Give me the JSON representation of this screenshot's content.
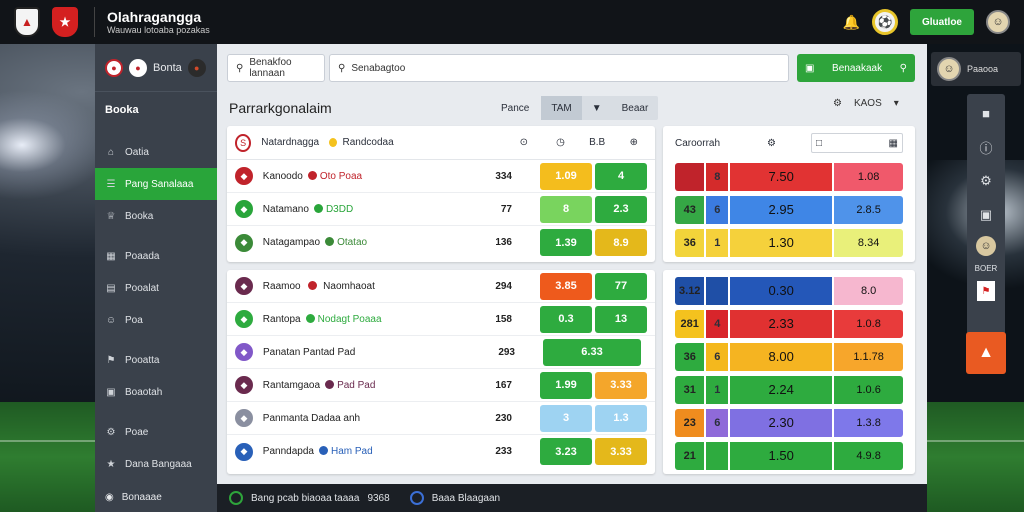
{
  "app": {
    "title": "Olahragangga",
    "subtitle": "Wauwau lotoaba pozakas"
  },
  "topbar": {
    "green_button": "Gluatloe",
    "ball_icon": "soccer-ball-icon",
    "bell_icon": "bell-icon"
  },
  "sidebar": {
    "heading": "Booka",
    "top_label": "Bonta",
    "items": [
      {
        "label": "Oatia",
        "icon": "home-icon"
      },
      {
        "label": "Pang Sanalaaa",
        "icon": "list-icon",
        "active": true
      },
      {
        "label": "Booka",
        "icon": "trophy-icon"
      },
      {
        "label": "Poaada",
        "icon": "calendar-icon"
      },
      {
        "label": "Pooalat",
        "icon": "chart-icon"
      },
      {
        "label": "Poa",
        "icon": "user-icon"
      },
      {
        "label": "Pooatta",
        "icon": "team-icon"
      },
      {
        "label": "Boaotah",
        "icon": "news-icon"
      },
      {
        "label": "Poae",
        "icon": "settings-icon"
      },
      {
        "label": "Dana Bangaaa",
        "icon": "star-icon"
      }
    ],
    "bottom_label": "Bonaaae"
  },
  "search": {
    "left_placeholder": "Benakfoo lannaan",
    "main_placeholder": "Senabagtoo",
    "green_button": "Benaakaak"
  },
  "main": {
    "title": "Parrarkgonalaim",
    "toolbar_label": "Pance",
    "segments": [
      "TAM",
      "▼",
      "Beaar"
    ],
    "right_label": "KAOS"
  },
  "table_top": {
    "header": {
      "team_a": "Natardnagga",
      "team_b": "Randcodaa",
      "col1": "⊙",
      "col2": "◷",
      "col3": "B.B",
      "col4": "⊕"
    },
    "rows": [
      {
        "team": "Kanoodo",
        "sub": "Oto Poaa",
        "crest": "#c0232b",
        "stat": "334",
        "p1": "1.09",
        "p1c": "#f4bd1d",
        "p2": "4",
        "p2c": "#2eab3f"
      },
      {
        "team": "Natamano",
        "sub": "D3DD",
        "crest": "#29a53a",
        "stat": "77",
        "p1": "8",
        "p1c": "#79d45e",
        "p2": "2.3",
        "p2c": "#2eab3f"
      },
      {
        "team": "Natagampao",
        "sub": "Otatao",
        "crest": "#3b8a38",
        "stat": "136",
        "p1": "1.39",
        "p1c": "#2eab3f",
        "p2": "8.9",
        "p2c": "#e4b81b"
      }
    ]
  },
  "table_bottom": {
    "header": {
      "team_a": "Raamoo",
      "team_b": "Naomhaoat",
      "stat": "294",
      "p1": "3.85",
      "p1c": "#ee5a1c",
      "p2": "77",
      "p2c": "#2eab3f",
      "crest": "#6a2a4e"
    },
    "rows": [
      {
        "team": "Rantopa",
        "sub": "Nodagt Poaaa",
        "crest": "#2eab3f",
        "stat": "158",
        "p1": "0.3",
        "p1c": "#2eab3f",
        "p2": "13",
        "p2c": "#2eab3f",
        "wide": false
      },
      {
        "team": "Panatan Pantad Pad",
        "sub": "",
        "crest": "#8158c8",
        "stat": "293",
        "p1": "6.33",
        "p1c": "#2eab3f",
        "p2": "",
        "p2c": "",
        "wide": true
      },
      {
        "team": "Rantamgaoa",
        "sub": "Pad Pad",
        "crest": "#6a2a4e",
        "stat": "167",
        "p1": "1.99",
        "p1c": "#2eab3f",
        "p2": "3.33",
        "p2c": "#f4a62b",
        "wide": false
      },
      {
        "team": "Panmanta Dadaa anh",
        "sub": "",
        "crest": "#8a8fa0",
        "stat": "230",
        "p1": "3",
        "p1c": "#9ed3f2",
        "p2": "1.3",
        "p2c": "#9ed3f2",
        "wide": false
      },
      {
        "team": "Panndapda",
        "sub": "Ham Pad",
        "crest": "#2960b8",
        "stat": "233",
        "p1": "3.23",
        "p1c": "#2eab3f",
        "p2": "3.33",
        "p2c": "#e4b81b",
        "wide": false
      }
    ]
  },
  "odds_top": {
    "header": "Caroorrah",
    "rows": [
      {
        "a": "",
        "ac": "#c0232b",
        "b": "8",
        "bc": "#d42b2b",
        "c": "7.50",
        "cc": "#e13333",
        "d": "1.08",
        "dc": "#f0596b"
      },
      {
        "a": "43",
        "ac": "#35a845",
        "b": "6",
        "bc": "#3b7be0",
        "c": "2.95",
        "cc": "#3f86e6",
        "d": "2.8.5",
        "dc": "#4f93ea"
      },
      {
        "a": "36",
        "ac": "#f2d43a",
        "b": "1",
        "bc": "#f5d13b",
        "c": "1.30",
        "cc": "#f5d13b",
        "d": "8.34",
        "dc": "#e9f07a"
      }
    ]
  },
  "odds_bottom": {
    "rows": [
      {
        "a": "3.12",
        "ac": "#1f4fa6",
        "b": "",
        "bc": "#1f4fa6",
        "c": "0.30",
        "cc": "#2457b8",
        "d": "8.0",
        "dc": "#f6b7cf"
      },
      {
        "a": "281",
        "ac": "#f4c21e",
        "b": "4",
        "bc": "#d8252b",
        "c": "2.33",
        "cc": "#e03131",
        "d": "1.0.8",
        "dc": "#e83b3b"
      },
      {
        "a": "36",
        "ac": "#2eab3f",
        "b": "6",
        "bc": "#f4b81d",
        "c": "8.00",
        "cc": "#f5b421",
        "d": "1.1.78",
        "dc": "#f7a62b"
      },
      {
        "a": "31",
        "ac": "#2eab3f",
        "b": "1",
        "bc": "#2eab3f",
        "c": "2.24",
        "cc": "#2eab3f",
        "d": "1.0.6",
        "dc": "#2eab3f"
      },
      {
        "a": "23",
        "ac": "#ef8c1e",
        "b": "6",
        "bc": "#8f6ad9",
        "c": "2.30",
        "cc": "#7f70e2",
        "d": "1.3.8",
        "dc": "#7e78ea"
      },
      {
        "a": "21",
        "ac": "#2eab3f",
        "b": "",
        "bc": "#2eab3f",
        "c": "1.50",
        "cc": "#2eab3f",
        "d": "4.9.8",
        "dc": "#2eab3f"
      }
    ]
  },
  "footer": {
    "left_text": "Bang pcab biaoaa taaaa",
    "num": "9368",
    "right_text": "Baaa Blaagaan"
  },
  "rail": {
    "top_label": "Paaooa",
    "label": "BOER"
  }
}
